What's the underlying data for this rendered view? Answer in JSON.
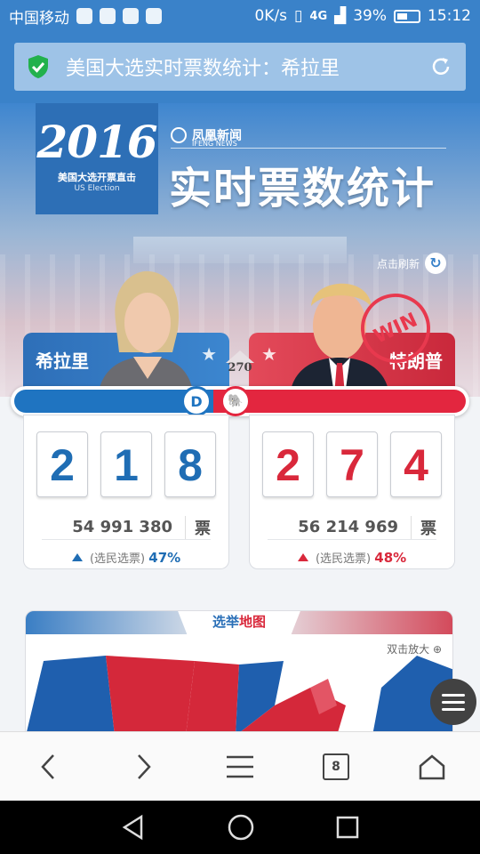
{
  "status_bar": {
    "carrier": "中国移动",
    "speed": "0K/s",
    "network": "4G",
    "battery": "39%",
    "time": "15:12"
  },
  "url_bar": {
    "title": "美国大选实时票数统计：希拉里"
  },
  "banner": {
    "year": "2016",
    "year_sub": "美国大选开票直击",
    "year_sub_en": "US Election",
    "brand": "凤凰新闻",
    "brand_en": "IFENG NEWS",
    "headline": "实时票数统计",
    "refresh_label": "点击刷新"
  },
  "threshold": "270",
  "candidates": {
    "left": {
      "name": "希拉里",
      "party_badge": "D",
      "electoral_digits": [
        "2",
        "1",
        "8"
      ],
      "popular_votes": "54 991 380",
      "votes_unit": "票",
      "vote_share_label": "(选民选票)",
      "vote_share": "47%",
      "color": "#1f74c1"
    },
    "right": {
      "name": "特朗普",
      "win_stamp": "WIN",
      "electoral_digits": [
        "2",
        "7",
        "4"
      ],
      "popular_votes": "56 214 969",
      "votes_unit": "票",
      "vote_share_label": "(选民选票)",
      "vote_share": "48%",
      "color": "#e3263f"
    }
  },
  "progress": {
    "left_fraction": 0.44,
    "right_fraction": 0.56
  },
  "map": {
    "tab_part1": "选举",
    "tab_part2": "地图",
    "zoom_hint": "双击放大"
  },
  "toolbar": {
    "tab_count": "8"
  }
}
